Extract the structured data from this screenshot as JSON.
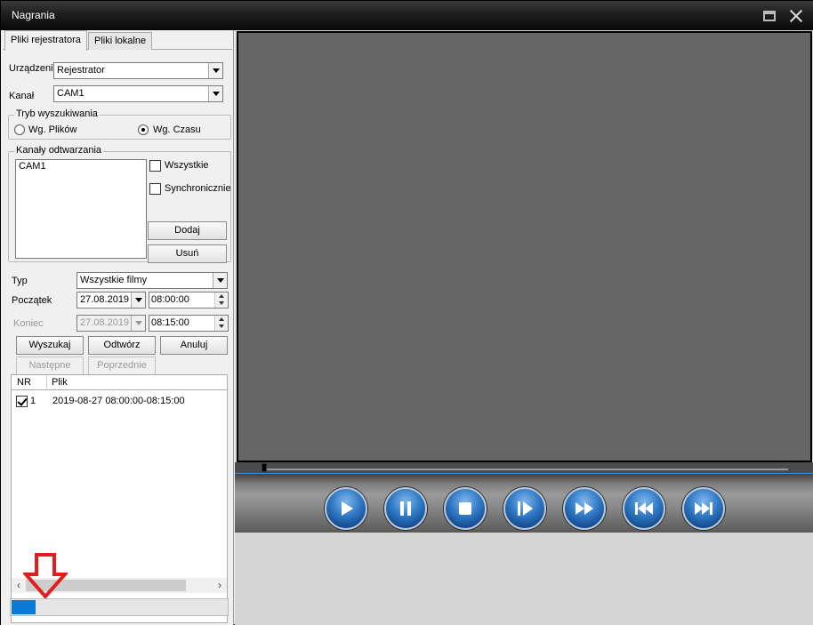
{
  "window": {
    "title": "Nagrania"
  },
  "tabs": [
    {
      "label": "Pliki rejestratora",
      "active": true
    },
    {
      "label": "Pliki lokalne",
      "active": false
    }
  ],
  "device": {
    "label": "Urządzenie",
    "value": "Rejestrator"
  },
  "channel": {
    "label": "Kanał",
    "value": "CAM1"
  },
  "search_mode": {
    "label": "Tryb wyszukiwania",
    "options": [
      {
        "label": "Wg. Plików",
        "checked": false
      },
      {
        "label": "Wg. Czasu",
        "checked": true
      }
    ]
  },
  "playback_channels": {
    "label": "Kanały odtwarzania",
    "items": [
      "CAM1"
    ],
    "all_label": "Wszystkie",
    "sync_label": "Synchronicznie",
    "add_label": "Dodaj",
    "remove_label": "Usuń"
  },
  "filter": {
    "type_label": "Typ",
    "type_value": "Wszystkie filmy",
    "start_label": "Początek",
    "start_date": "27.08.2019",
    "start_time": "08:00:00",
    "end_label": "Koniec",
    "end_date": "27.08.2019",
    "end_time": "08:15:00"
  },
  "actions": {
    "search": "Wyszukaj",
    "play": "Odtwórz",
    "cancel": "Anuluj",
    "next": "Następne",
    "prev": "Poprzednie"
  },
  "results": {
    "columns": [
      "NR",
      "Plik"
    ],
    "rows": [
      {
        "nr": "1",
        "file": "2019-08-27 08:00:00-08:15:00",
        "checked": true
      }
    ]
  },
  "progress": {
    "fraction": 0.11
  },
  "player": {
    "seek_fraction": 0.0,
    "buttons": [
      "play",
      "pause",
      "stop",
      "step-forward",
      "fast-forward",
      "skip-back",
      "skip-forward"
    ]
  },
  "colors": {
    "accent": "#0a7ad8",
    "video_bg": "#666666",
    "annotation_arrow": "#e01e1e"
  }
}
